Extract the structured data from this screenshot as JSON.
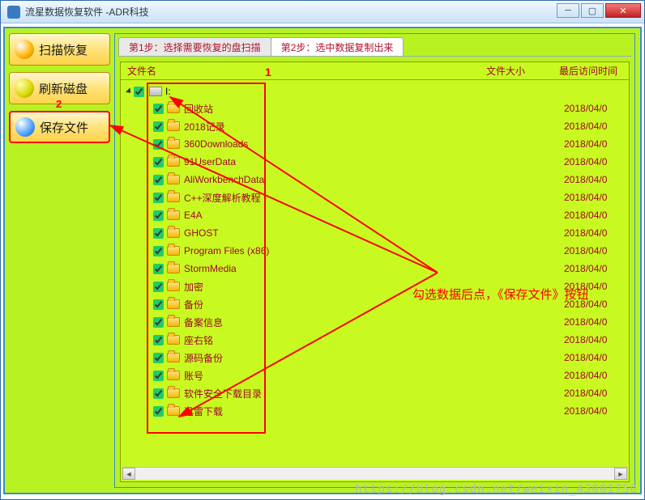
{
  "window": {
    "title": "流星数据恢复软件   -ADR科技"
  },
  "sidebar": {
    "scan": "扫描恢复",
    "refresh": "刷新磁盘",
    "save": "保存文件"
  },
  "tabs": {
    "step1": "第1步：选择需要恢复的盘扫描",
    "step2": "第2步：选中数据复制出来"
  },
  "columns": {
    "name": "文件名",
    "size": "文件大小",
    "time": "最后访问时间"
  },
  "root": {
    "label": "I:"
  },
  "items": [
    {
      "name": "回收站",
      "date": "2018/04/0"
    },
    {
      "name": "2018记录",
      "date": "2018/04/0"
    },
    {
      "name": "360Downloads",
      "date": "2018/04/0"
    },
    {
      "name": "91UserData",
      "date": "2018/04/0"
    },
    {
      "name": "AliWorkbenchData",
      "date": "2018/04/0"
    },
    {
      "name": "C++深度解析教程",
      "date": "2018/04/0"
    },
    {
      "name": "E4A",
      "date": "2018/04/0"
    },
    {
      "name": "GHOST",
      "date": "2018/04/0"
    },
    {
      "name": "Program Files (x86)",
      "date": "2018/04/0"
    },
    {
      "name": "StormMedia",
      "date": "2018/04/0"
    },
    {
      "name": "加密",
      "date": "2018/04/0"
    },
    {
      "name": "备份",
      "date": "2018/04/0"
    },
    {
      "name": "备案信息",
      "date": "2018/04/0"
    },
    {
      "name": "座右铭",
      "date": "2018/04/0"
    },
    {
      "name": "源码备份",
      "date": "2018/04/0"
    },
    {
      "name": "账号",
      "date": "2018/04/0"
    },
    {
      "name": "软件安全下载目录",
      "date": "2018/04/0"
    },
    {
      "name": "迅雷下载",
      "date": "2018/04/0"
    }
  ],
  "annotations": {
    "label1": "1",
    "label2": "2",
    "hint": "勾选数据后点，《保存文件》按钮",
    "watermark": "https://blog.csdn.net/weixin_43001750"
  }
}
